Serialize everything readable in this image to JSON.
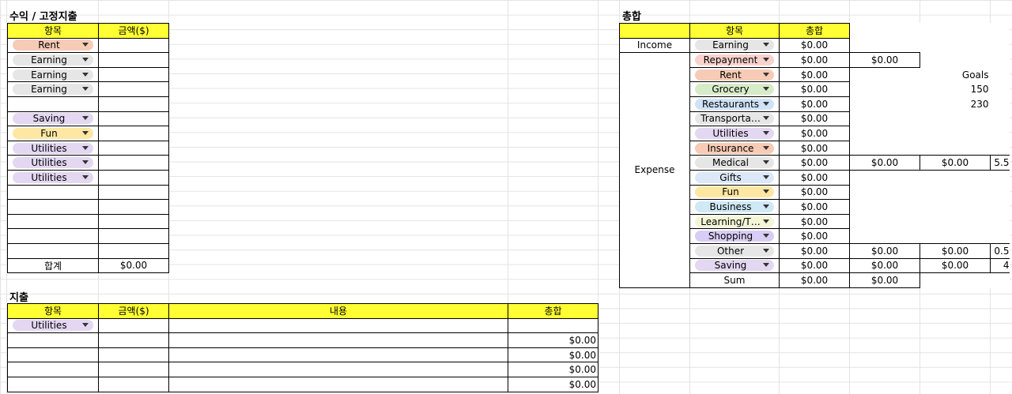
{
  "colors": {
    "header_yellow": "#ffff33",
    "chip_rent": "#f7cbb5",
    "chip_earning": "#e6e6e6",
    "chip_saving": "#e3d7f2",
    "chip_fun": "#fde7a2",
    "chip_utilities": "#e3d7f2",
    "chip_repayment": "#f9d2cd",
    "chip_grocery": "#d6ecc8",
    "chip_restaurants": "#cfe2f7",
    "chip_transport": "#e6e6e6",
    "chip_insurance": "#f7cbb5",
    "chip_medical": "#e6e6e6",
    "chip_gifts": "#dce8f8",
    "chip_business": "#cfe9f5",
    "chip_learning": "#f3f6d6",
    "chip_shopping": "#d8cdf4",
    "chip_other": "#e6e6e6"
  },
  "income_fixed": {
    "title": "수익 / 고정지출",
    "headers": [
      "항목",
      "금액($)"
    ],
    "rows": [
      {
        "category": "Rent",
        "chip": "chip_rent",
        "amount": ""
      },
      {
        "category": "Earning",
        "chip": "chip_earning",
        "amount": ""
      },
      {
        "category": "Earning",
        "chip": "chip_earning",
        "amount": ""
      },
      {
        "category": "Earning",
        "chip": "chip_earning",
        "amount": ""
      },
      {
        "category": "",
        "chip": "",
        "amount": ""
      },
      {
        "category": "Saving",
        "chip": "chip_saving",
        "amount": ""
      },
      {
        "category": "Fun",
        "chip": "chip_fun",
        "amount": ""
      },
      {
        "category": "Utilities",
        "chip": "chip_utilities",
        "amount": ""
      },
      {
        "category": "Utilities",
        "chip": "chip_utilities",
        "amount": ""
      },
      {
        "category": "Utilities",
        "chip": "chip_utilities",
        "amount": ""
      },
      {
        "category": "",
        "chip": "",
        "amount": ""
      },
      {
        "category": "",
        "chip": "",
        "amount": ""
      },
      {
        "category": "",
        "chip": "",
        "amount": ""
      },
      {
        "category": "",
        "chip": "",
        "amount": ""
      },
      {
        "category": "",
        "chip": "",
        "amount": ""
      }
    ],
    "total_label": "합계",
    "total_value": "$0.00"
  },
  "expenses": {
    "title": "지출",
    "headers": [
      "항목",
      "금액($)",
      "내용",
      "총합"
    ],
    "rows": [
      {
        "category": "Utilities",
        "chip": "chip_utilities",
        "amount": "",
        "desc": "",
        "total": ""
      },
      {
        "category": "",
        "chip": "",
        "amount": "",
        "desc": "",
        "total": "$0.00"
      },
      {
        "category": "",
        "chip": "",
        "amount": "",
        "desc": "",
        "total": "$0.00"
      },
      {
        "category": "",
        "chip": "",
        "amount": "",
        "desc": "",
        "total": "$0.00"
      },
      {
        "category": "",
        "chip": "",
        "amount": "",
        "desc": "",
        "total": "$0.00"
      }
    ]
  },
  "summary": {
    "title": "총합",
    "headers": [
      "",
      "항목",
      "총합"
    ],
    "income_label": "Income",
    "income_row": {
      "category": "Earning",
      "chip": "chip_earning",
      "total": "$0.00"
    },
    "expense_label": "Expense",
    "expense_rows": [
      {
        "category": "Repayment",
        "chip": "chip_repayment",
        "total": "$0.00",
        "c4": "$0.00",
        "c5": "",
        "c6": ""
      },
      {
        "category": "Rent",
        "chip": "chip_rent",
        "total": "$0.00",
        "c4": "",
        "c5": "Goals",
        "c6": ""
      },
      {
        "category": "Grocery",
        "chip": "chip_grocery",
        "total": "$0.00",
        "c4": "",
        "c5": "150",
        "c6": ""
      },
      {
        "category": "Restaurants",
        "chip": "chip_restaurants",
        "total": "$0.00",
        "c4": "",
        "c5": "230",
        "c6": ""
      },
      {
        "category": "Transporta…",
        "chip": "chip_transport",
        "total": "$0.00",
        "c4": "",
        "c5": "",
        "c6": ""
      },
      {
        "category": "Utilities",
        "chip": "chip_utilities",
        "total": "$0.00",
        "c4": "",
        "c5": "",
        "c6": ""
      },
      {
        "category": "Insurance",
        "chip": "chip_insurance",
        "total": "$0.00",
        "c4": "",
        "c5": "",
        "c6": ""
      },
      {
        "category": "Medical",
        "chip": "chip_medical",
        "total": "$0.00",
        "c4": "$0.00",
        "c5": "$0.00",
        "c6": "5.5"
      },
      {
        "category": "Gifts",
        "chip": "chip_gifts",
        "total": "$0.00",
        "c4": "",
        "c5": "",
        "c6": ""
      },
      {
        "category": "Fun",
        "chip": "chip_fun",
        "total": "$0.00",
        "c4": "",
        "c5": "",
        "c6": ""
      },
      {
        "category": "Business",
        "chip": "chip_business",
        "total": "$0.00",
        "c4": "",
        "c5": "",
        "c6": ""
      },
      {
        "category": "Learning/T…",
        "chip": "chip_learning",
        "total": "$0.00",
        "c4": "",
        "c5": "",
        "c6": ""
      },
      {
        "category": "Shopping",
        "chip": "chip_shopping",
        "total": "$0.00",
        "c4": "",
        "c5": "",
        "c6": ""
      },
      {
        "category": "Other",
        "chip": "chip_other",
        "total": "$0.00",
        "c4": "$0.00",
        "c5": "$0.00",
        "c6": "0.5"
      },
      {
        "category": "Saving",
        "chip": "chip_saving",
        "total": "$0.00",
        "c4": "$0.00",
        "c5": "$0.00",
        "c6": "4"
      }
    ],
    "sum_label": "Sum",
    "sum_total": "$0.00",
    "sum_c4": "$0.00"
  }
}
